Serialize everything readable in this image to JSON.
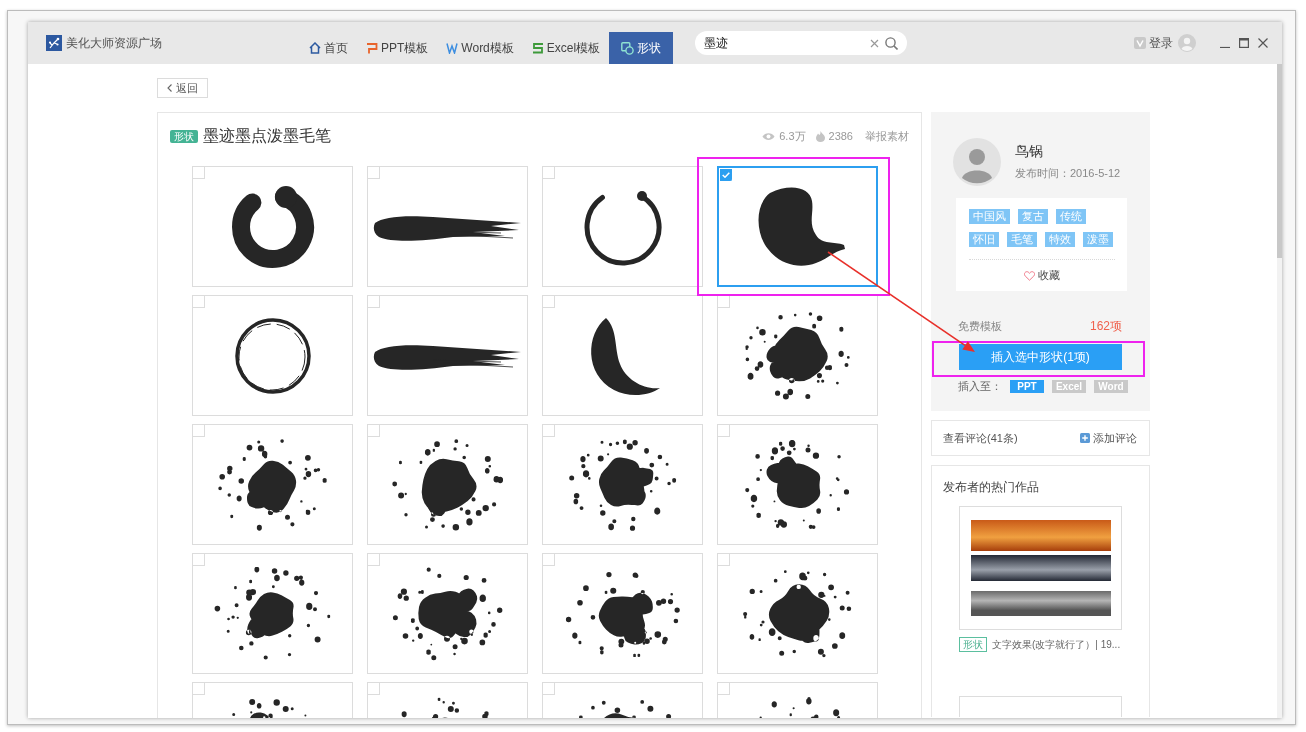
{
  "window": {
    "title": "美化大师资源广场"
  },
  "nav": [
    {
      "label": "首页",
      "kind": "home",
      "selected": false
    },
    {
      "label": "PPT模板",
      "kind": "ppt",
      "selected": false
    },
    {
      "label": "Word模板",
      "kind": "word",
      "selected": false
    },
    {
      "label": "Excel模板",
      "kind": "excel",
      "selected": false
    },
    {
      "label": "形状",
      "kind": "shape",
      "selected": true
    }
  ],
  "search": {
    "value": "墨迹"
  },
  "account": {
    "login": "登录"
  },
  "back_button": "返回",
  "item": {
    "tag": "形状",
    "title": "墨迹墨点泼墨毛笔",
    "views": "6.3万",
    "likes": "2386",
    "report": "举报素材"
  },
  "tiles": [
    {
      "kind": "ring",
      "selected": false
    },
    {
      "kind": "stroke",
      "selected": false
    },
    {
      "kind": "arc",
      "selected": false
    },
    {
      "kind": "blob",
      "selected": true
    },
    {
      "kind": "circle",
      "selected": false
    },
    {
      "kind": "stroke",
      "selected": false
    },
    {
      "kind": "crescent",
      "selected": false
    },
    {
      "kind": "splash",
      "selected": false
    },
    {
      "kind": "splash",
      "selected": false
    },
    {
      "kind": "splash",
      "selected": false
    },
    {
      "kind": "splash",
      "selected": false
    },
    {
      "kind": "splash",
      "selected": false
    },
    {
      "kind": "splash",
      "selected": false
    },
    {
      "kind": "splash",
      "selected": false
    },
    {
      "kind": "splash",
      "selected": false
    },
    {
      "kind": "splash",
      "selected": false
    },
    {
      "kind": "splash",
      "selected": false
    },
    {
      "kind": "splash",
      "selected": false
    },
    {
      "kind": "splash",
      "selected": false
    },
    {
      "kind": "splash",
      "selected": false
    }
  ],
  "author": {
    "name": "鸟锅",
    "published": "发布时间：2016-5-12",
    "tags": [
      "中国风",
      "复古",
      "传统",
      "怀旧",
      "毛笔",
      "特效",
      "泼墨"
    ],
    "favorite": "收藏"
  },
  "free_templates": {
    "label": "免费模板",
    "count": "162项"
  },
  "insert_button": "插入选中形状(1项)",
  "insert_to": {
    "label": "插入至：",
    "targets": [
      {
        "label": "PPT",
        "selected": true
      },
      {
        "label": "Excel",
        "selected": false
      },
      {
        "label": "Word",
        "selected": false
      }
    ]
  },
  "comments": {
    "view": "查看评论(41条)",
    "add": "添加评论"
  },
  "hot_works": {
    "title": "发布者的热门作品",
    "items": [
      {
        "tag": "形状",
        "caption": "文字效果(改字就行了）| 19..."
      }
    ]
  }
}
